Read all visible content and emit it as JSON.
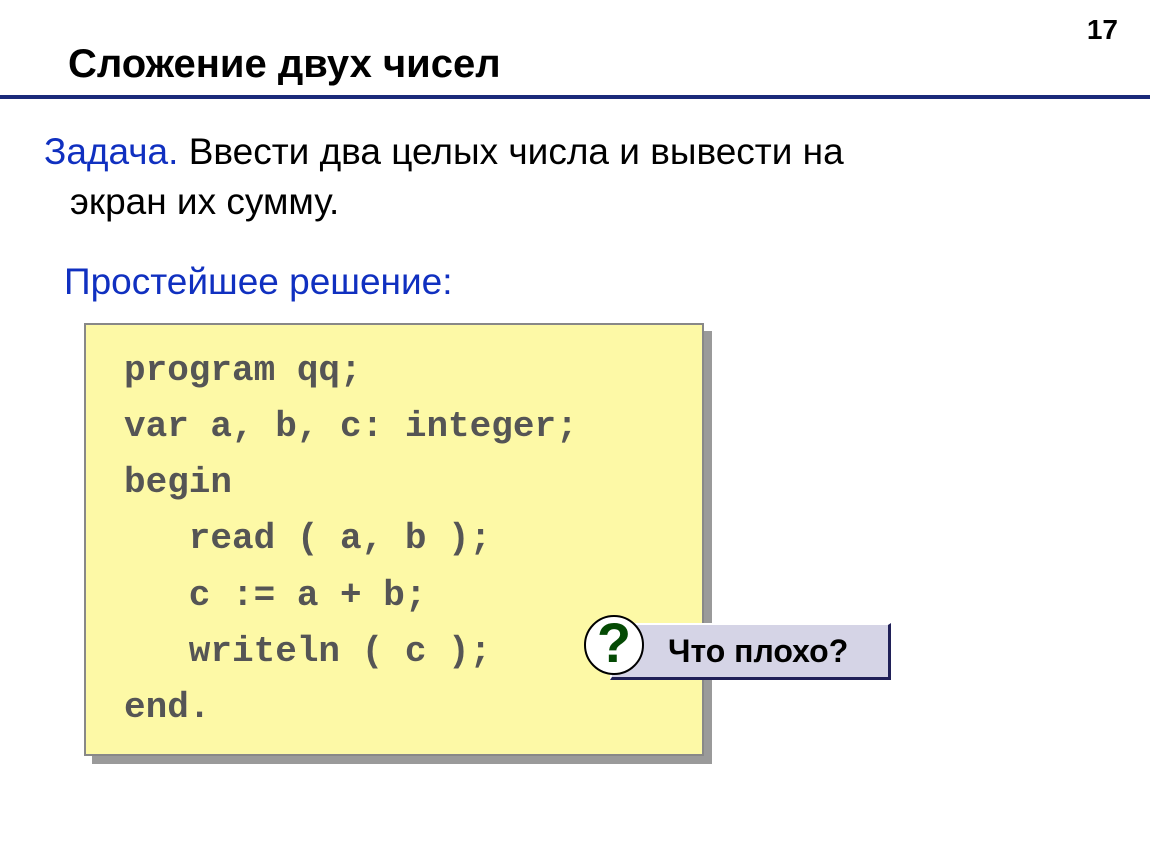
{
  "page_number": "17",
  "title": "Сложение двух чисел",
  "task": {
    "label": "Задача.",
    "line1_rest": " Ввести два целых числа и вывести на",
    "line2": "экран их сумму."
  },
  "solution_label": "Простейшее решение:",
  "code": {
    "l1": "program qq;",
    "l2": "var a, b, c: integer;",
    "l3": "begin",
    "l4": "   read ( a, b );",
    "l5": "   c := a + b;",
    "l6": "   writeln ( c );",
    "l7": "end."
  },
  "callout": {
    "mark": "?",
    "text": "Что плохо?"
  }
}
